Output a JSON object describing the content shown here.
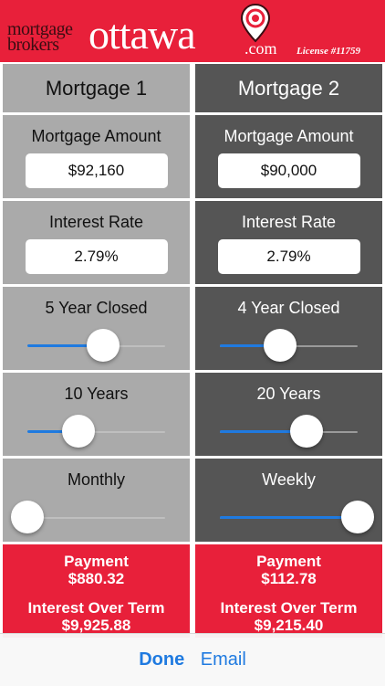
{
  "header": {
    "brand_line1": "mortgage",
    "brand_line2": "brokers",
    "brand_main": "ottawa",
    "brand_suffix": ".com",
    "license": "License #11759",
    "pin_icon": "location-pin-icon",
    "color_brand": "#e8203a"
  },
  "mortgage1": {
    "title": "Mortgage 1",
    "amount_label": "Mortgage Amount",
    "amount_value": "$92,160",
    "rate_label": "Interest Rate",
    "rate_value": "2.79%",
    "term_label": "5 Year Closed",
    "term_slider": 0.55,
    "amort_label": "10 Years",
    "amort_slider": 0.37,
    "freq_label": "Monthly",
    "freq_slider": 0.0,
    "payment_label": "Payment",
    "payment_value": "$880.32",
    "interest_label": "Interest Over Term",
    "interest_value": "$9,925.88"
  },
  "mortgage2": {
    "title": "Mortgage 2",
    "amount_label": "Mortgage Amount",
    "amount_value": "$90,000",
    "rate_label": "Interest Rate",
    "rate_value": "2.79%",
    "term_label": "4 Year Closed",
    "term_slider": 0.44,
    "amort_label": "20 Years",
    "amort_slider": 0.63,
    "freq_label": "Weekly",
    "freq_slider": 1.0,
    "payment_label": "Payment",
    "payment_value": "$112.78",
    "interest_label": "Interest Over Term",
    "interest_value": "$9,215.40"
  },
  "toolbar": {
    "done_label": "Done",
    "email_label": "Email",
    "color_accent": "#1f7ae0"
  }
}
